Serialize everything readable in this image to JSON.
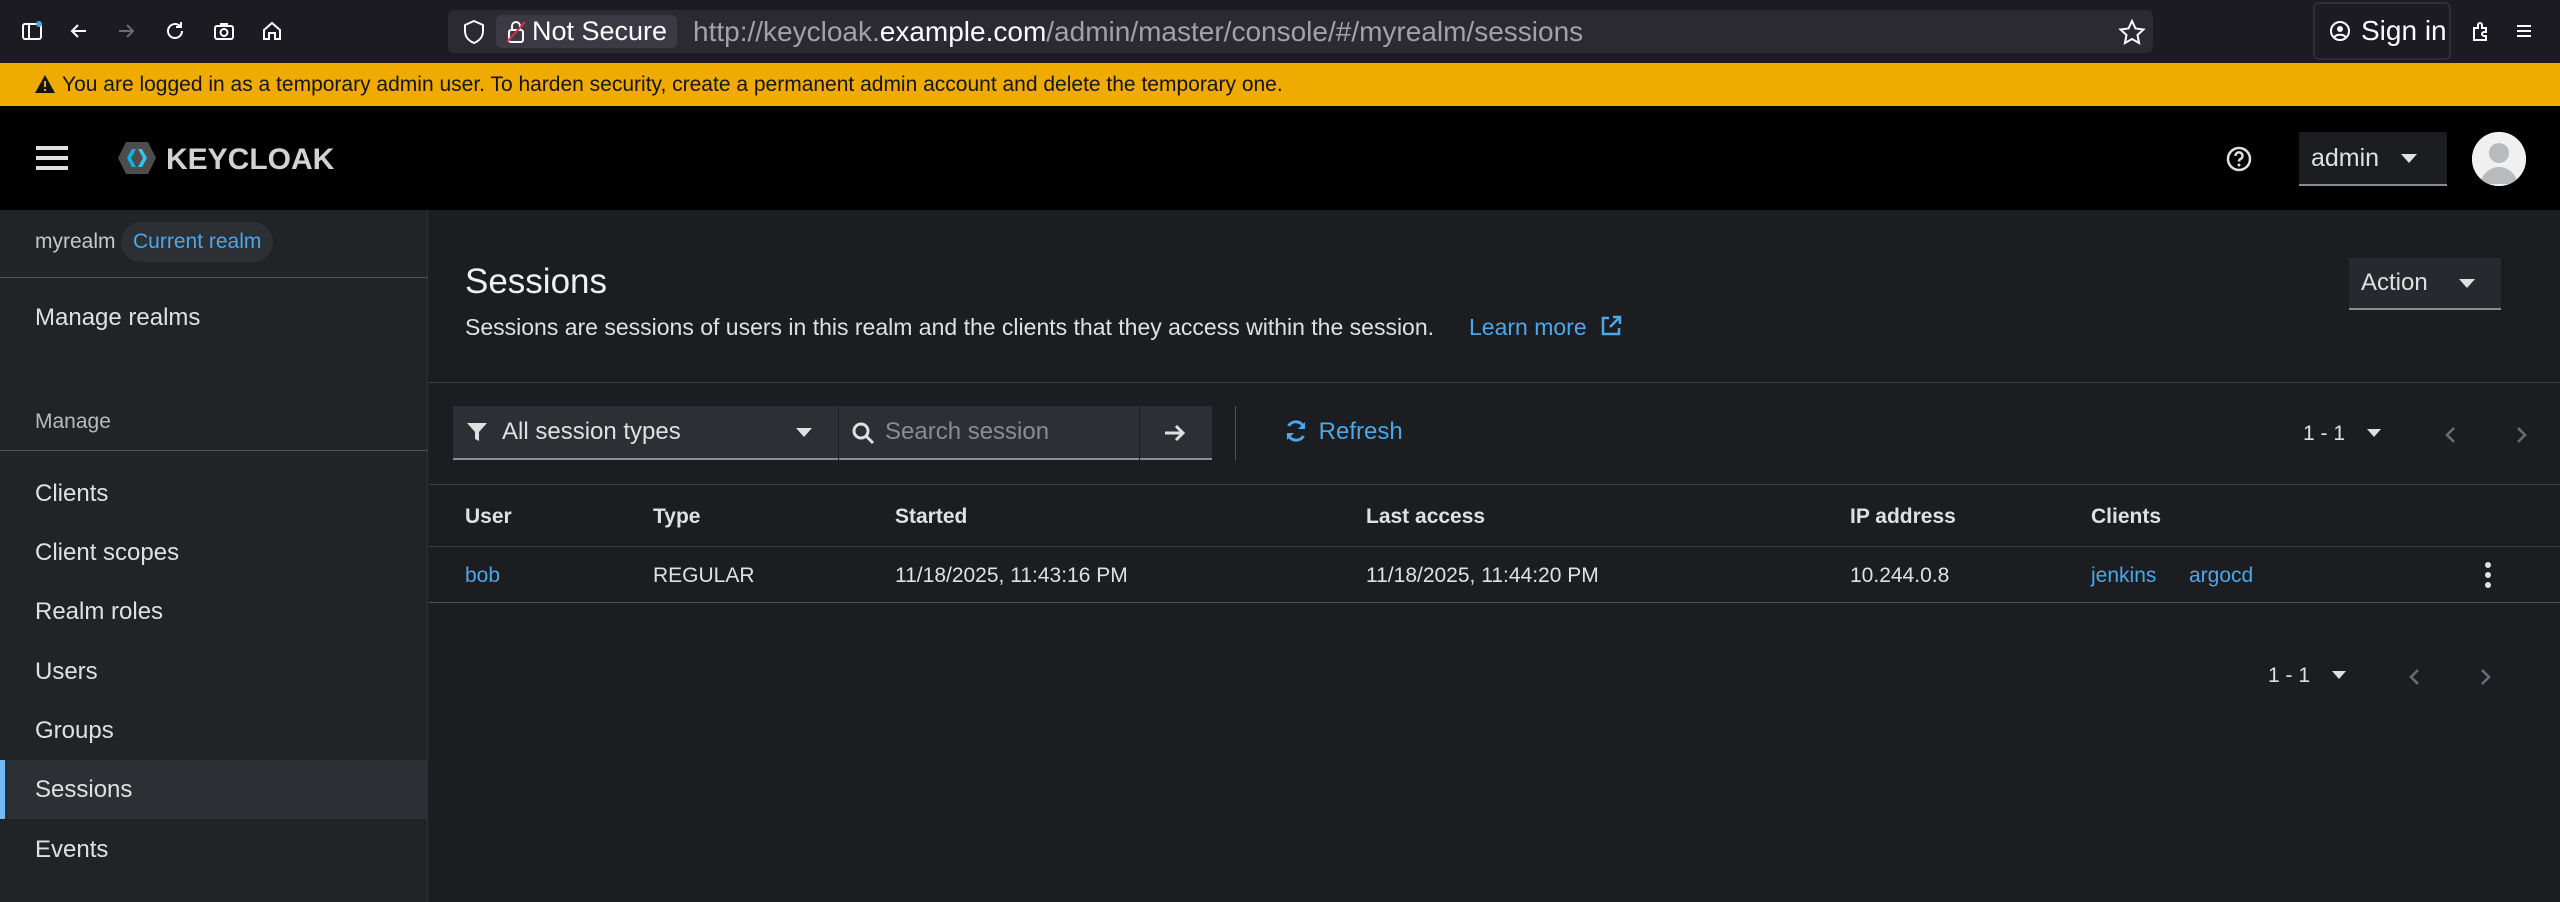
{
  "browser": {
    "security_label": "Not Secure",
    "url_prefix": "http://keycloak.",
    "url_domain": "example.com",
    "url_path": "/admin/master/console/#/myrealm/sessions",
    "signin_label": "Sign in"
  },
  "warning": {
    "text": "You are logged in as a temporary admin user. To harden security, create a permanent admin account and delete the temporary one."
  },
  "masthead": {
    "logo_text": "KEYCLOAK",
    "user_menu": "admin"
  },
  "sidebar": {
    "realm_name": "myrealm",
    "realm_badge": "Current realm",
    "manage_realms": "Manage realms",
    "section_label": "Manage",
    "items": [
      {
        "label": "Clients"
      },
      {
        "label": "Client scopes"
      },
      {
        "label": "Realm roles"
      },
      {
        "label": "Users"
      },
      {
        "label": "Groups"
      },
      {
        "label": "Sessions"
      },
      {
        "label": "Events"
      }
    ],
    "active_item": "Sessions"
  },
  "page": {
    "title": "Sessions",
    "description": "Sessions are sessions of users in this realm and the clients that they access within the session.",
    "learn_more": "Learn more",
    "action_label": "Action"
  },
  "toolbar": {
    "type_filter": "All session types",
    "search_placeholder": "Search session",
    "refresh_label": "Refresh",
    "pagination": "1 - 1"
  },
  "table": {
    "columns": [
      "User",
      "Type",
      "Started",
      "Last access",
      "IP address",
      "Clients"
    ],
    "rows": [
      {
        "user": "bob",
        "type": "REGULAR",
        "started": "11/18/2025, 11:43:16 PM",
        "last_access": "11/18/2025, 11:44:20 PM",
        "ip": "10.244.0.8",
        "clients": [
          "jenkins",
          "argocd"
        ]
      }
    ]
  },
  "footer": {
    "pagination": "1 - 1"
  },
  "colors": {
    "warning_bg": "#f0ab00",
    "link": "#4ca7e8",
    "active_accent": "#73bcf7"
  }
}
